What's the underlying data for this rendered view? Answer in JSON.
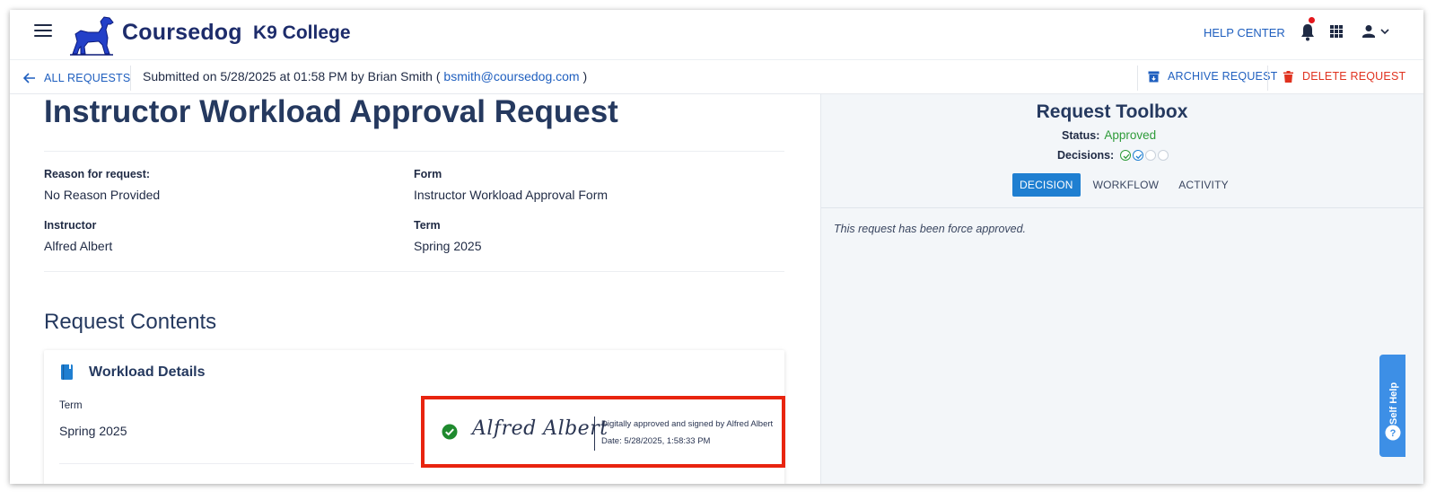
{
  "header": {
    "brand": "Coursedog",
    "college": "K9 College",
    "help_center": "HELP CENTER"
  },
  "subbar": {
    "back_label": "ALL REQUESTS",
    "submitted_prefix": "Submitted on 5/28/2025 at 01:58 PM by Brian Smith ( ",
    "submitted_email": "bsmith@coursedog.com",
    "submitted_suffix": " )",
    "archive_label": "ARCHIVE REQUEST",
    "delete_label": "DELETE REQUEST"
  },
  "request": {
    "title": "Instructor Workload Approval Request",
    "fields": {
      "reason_label": "Reason for request:",
      "reason_value": "No Reason Provided",
      "form_label": "Form",
      "form_value": "Instructor Workload Approval Form",
      "instructor_label": "Instructor",
      "instructor_value": "Alfred Albert",
      "term_label": "Term",
      "term_value": "Spring 2025"
    },
    "contents_title": "Request Contents",
    "card": {
      "title": "Workload Details",
      "term_label": "Term",
      "term_value": "Spring 2025"
    },
    "signature": {
      "name": "Alfred Albert",
      "line1": "Digitally approved and signed by Alfred Albert",
      "line2": "Date: 5/28/2025, 1:58:33 PM"
    }
  },
  "toolbox": {
    "title": "Request Toolbox",
    "status_label": "Status:",
    "status_value": "Approved",
    "decisions_label": "Decisions:",
    "decisions": [
      "approved",
      "force-approved",
      "pending",
      "pending"
    ],
    "tabs": [
      "DECISION",
      "WORKFLOW",
      "ACTIVITY"
    ],
    "active_tab": "DECISION",
    "message": "This request has been force approved."
  },
  "self_help": {
    "label": "Self Help"
  },
  "colors": {
    "accent": "#1f7fd1",
    "brand": "#1d2c6b",
    "approved": "#2e9b3a",
    "delete": "#e0321f",
    "highlight_border": "#e8240f"
  },
  "icons": [
    "hamburger-icon",
    "dog-logo-icon",
    "bell-icon",
    "apps-grid-icon",
    "user-icon",
    "chevron-down-icon",
    "arrow-left-icon",
    "archive-icon",
    "trash-icon",
    "book-icon",
    "check-circle-icon",
    "help-bubble-icon"
  ]
}
